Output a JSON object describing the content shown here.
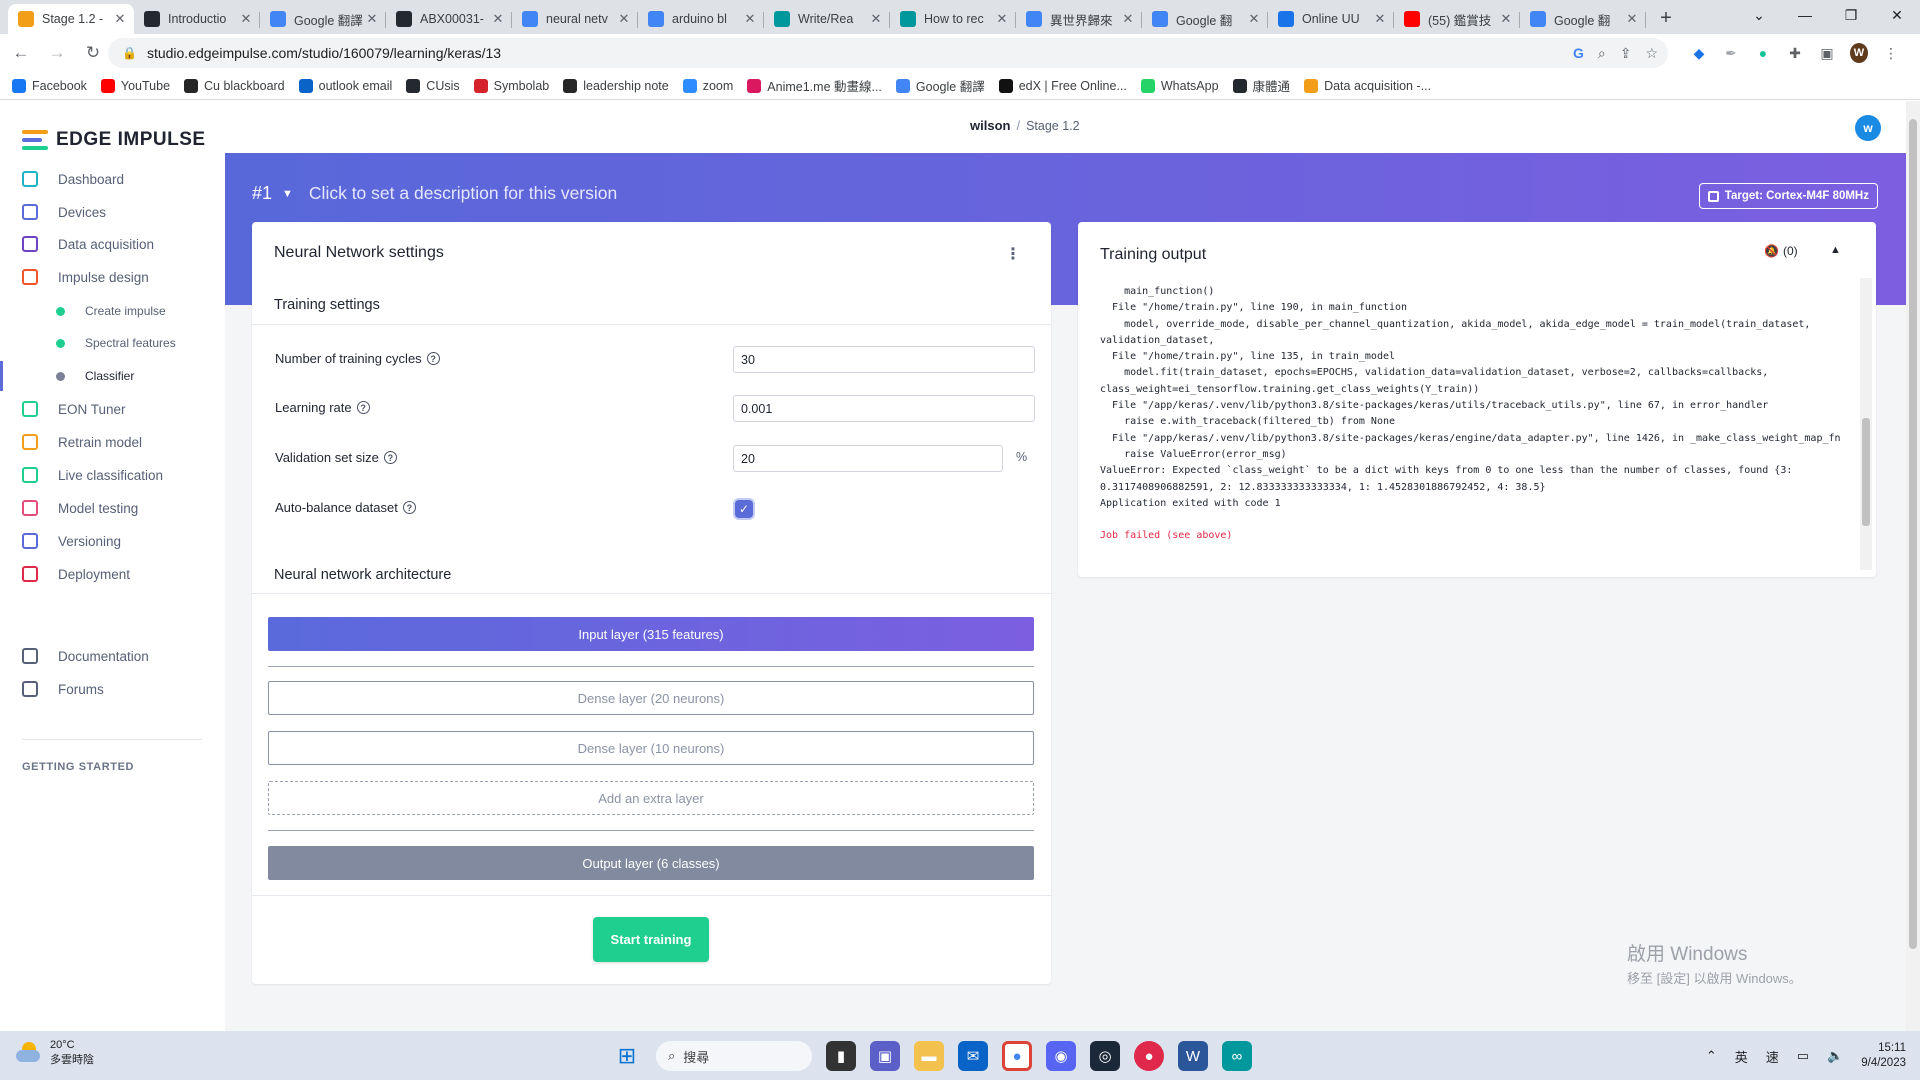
{
  "browser": {
    "tabs": [
      {
        "label": "Stage 1.2 -",
        "icon": "edge-impulse-icon",
        "color": "#f29e18",
        "active": true
      },
      {
        "label": "Introductio",
        "icon": "github-icon",
        "color": "#24292f"
      },
      {
        "label": "Google 翻譯",
        "icon": "google-translate-icon",
        "color": "#4285f4"
      },
      {
        "label": "ABX00031-",
        "icon": "github-icon",
        "color": "#24292f"
      },
      {
        "label": "neural netv",
        "icon": "google-icon",
        "color": "#4285f4"
      },
      {
        "label": "arduino bl",
        "icon": "google-icon",
        "color": "#4285f4"
      },
      {
        "label": "Write/Rea",
        "icon": "arduino-icon",
        "color": "#00979d"
      },
      {
        "label": "How to rec",
        "icon": "arduino-icon",
        "color": "#00979d"
      },
      {
        "label": "異世界歸來",
        "icon": "google-icon",
        "color": "#4285f4"
      },
      {
        "label": "Google 翻",
        "icon": "google-translate-icon",
        "color": "#4285f4"
      },
      {
        "label": "Online UU",
        "icon": "globe-icon",
        "color": "#1a73e8"
      },
      {
        "label": "(55) 鑑賞技",
        "icon": "youtube-icon",
        "color": "#ff0000"
      },
      {
        "label": "Google 翻",
        "icon": "google-translate-icon",
        "color": "#4285f4"
      }
    ],
    "new_tab": "+",
    "url": "studio.edgeimpulse.com/studio/160079/learning/keras/13",
    "profile_initial": "W",
    "bookmarks": [
      {
        "label": "Facebook",
        "icon": "facebook-icon",
        "color": "#1877f2"
      },
      {
        "label": "YouTube",
        "icon": "youtube-icon",
        "color": "#ff0000"
      },
      {
        "label": "Cu blackboard",
        "icon": "blackboard-icon",
        "color": "#262626"
      },
      {
        "label": "outlook email",
        "icon": "outlook-icon",
        "color": "#0a64c8"
      },
      {
        "label": "CUsis",
        "icon": "github-icon",
        "color": "#24292f"
      },
      {
        "label": "Symbolab",
        "icon": "symbolab-icon",
        "color": "#d4232a"
      },
      {
        "label": "leadership note",
        "icon": "blackboard-icon",
        "color": "#262626"
      },
      {
        "label": "zoom",
        "icon": "zoom-icon",
        "color": "#2d8cff"
      },
      {
        "label": "Anime1.me 動畫線...",
        "icon": "anime-icon",
        "color": "#d9185f"
      },
      {
        "label": "Google 翻譯",
        "icon": "google-translate-icon",
        "color": "#4285f4"
      },
      {
        "label": "edX | Free Online...",
        "icon": "edx-icon",
        "color": "#111111"
      },
      {
        "label": "WhatsApp",
        "icon": "whatsapp-icon",
        "color": "#25d366"
      },
      {
        "label": "康體通",
        "icon": "github-icon",
        "color": "#24292f"
      },
      {
        "label": "Data acquisition -...",
        "icon": "edge-impulse-icon",
        "color": "#f29e18"
      }
    ]
  },
  "app": {
    "logo_text": "EDGE IMPULSE",
    "breadcrumb": {
      "user": "wilson",
      "separator": "/",
      "project": "Stage 1.2"
    },
    "user_initial": "w",
    "sidebar": {
      "items": [
        {
          "label": "Dashboard",
          "icon": "monitor-icon",
          "color": "#20b3c4"
        },
        {
          "label": "Devices",
          "icon": "devices-icon",
          "color": "#5b6bd8"
        },
        {
          "label": "Data acquisition",
          "icon": "database-icon",
          "color": "#6f42c1"
        },
        {
          "label": "Impulse design",
          "icon": "pulse-icon",
          "color": "#f0552b"
        }
      ],
      "subitems": [
        {
          "label": "Create impulse",
          "color": "#1fcf8f"
        },
        {
          "label": "Spectral features",
          "color": "#1fcf8f"
        },
        {
          "label": "Classifier",
          "color": "#7b8196"
        }
      ],
      "items2": [
        {
          "label": "EON Tuner",
          "icon": "tuner-icon",
          "color": "#1fcf8f"
        },
        {
          "label": "Retrain model",
          "icon": "shuffle-icon",
          "color": "#f29e18"
        },
        {
          "label": "Live classification",
          "icon": "live-icon",
          "color": "#1fcf8f"
        },
        {
          "label": "Model testing",
          "icon": "flask-icon",
          "color": "#e64c7a"
        },
        {
          "label": "Versioning",
          "icon": "branch-icon",
          "color": "#5b6bd8"
        },
        {
          "label": "Deployment",
          "icon": "box-icon",
          "color": "#e0284a"
        }
      ],
      "section_title": "GETTING STARTED",
      "items3": [
        {
          "label": "Documentation",
          "icon": "rocket-icon",
          "color": "#566076"
        },
        {
          "label": "Forums",
          "icon": "chat-icon",
          "color": "#566076"
        }
      ]
    },
    "version": {
      "number": "#1",
      "description": "Click to set a description for this version"
    },
    "target_label": "Target: Cortex-M4F 80MHz",
    "nn": {
      "title": "Neural Network settings",
      "training_settings_title": "Training settings",
      "fields": {
        "cycles_label": "Number of training cycles",
        "cycles_value": "30",
        "lr_label": "Learning rate",
        "lr_value": "0.001",
        "val_label": "Validation set size",
        "val_value": "20",
        "val_unit": "%",
        "auto_label": "Auto-balance dataset",
        "auto_checked": true
      },
      "architecture_title": "Neural network architecture",
      "layers": {
        "input": "Input layer (315 features)",
        "dense1": "Dense layer (20 neurons)",
        "dense2": "Dense layer (10 neurons)",
        "add": "Add an extra layer",
        "output": "Output layer (6 classes)"
      },
      "start_button": "Start training"
    },
    "output": {
      "title": "Training output",
      "notifications": "(0)",
      "log_lines": [
        "    main_function()",
        "  File \"/home/train.py\", line 190, in main_function",
        "    model, override_mode, disable_per_channel_quantization, akida_model, akida_edge_model = train_model(train_dataset,",
        "validation_dataset,",
        "  File \"/home/train.py\", line 135, in train_model",
        "    model.fit(train_dataset, epochs=EPOCHS, validation_data=validation_dataset, verbose=2, callbacks=callbacks,",
        "class_weight=ei_tensorflow.training.get_class_weights(Y_train))",
        "  File \"/app/keras/.venv/lib/python3.8/site-packages/keras/utils/traceback_utils.py\", line 67, in error_handler",
        "    raise e.with_traceback(filtered_tb) from None",
        "  File \"/app/keras/.venv/lib/python3.8/site-packages/keras/engine/data_adapter.py\", line 1426, in _make_class_weight_map_fn",
        "    raise ValueError(error_msg)",
        "ValueError: Expected `class_weight` to be a dict with keys from 0 to one less than the number of classes, found {3:",
        "0.3117408906882591, 2: 12.833333333333334, 1: 1.4528301886792452, 4: 38.5}",
        "Application exited with code 1",
        "",
        "Job failed (see above)"
      ]
    },
    "watermark": {
      "line1": "啟用 Windows",
      "line2": "移至 [設定] 以啟用 Windows。"
    }
  },
  "taskbar": {
    "temperature": "20°C",
    "weather": "多雲時陰",
    "search_placeholder": "搜尋",
    "lang1": "英",
    "lang2": "速",
    "time": "15:11",
    "date": "9/4/2023"
  }
}
